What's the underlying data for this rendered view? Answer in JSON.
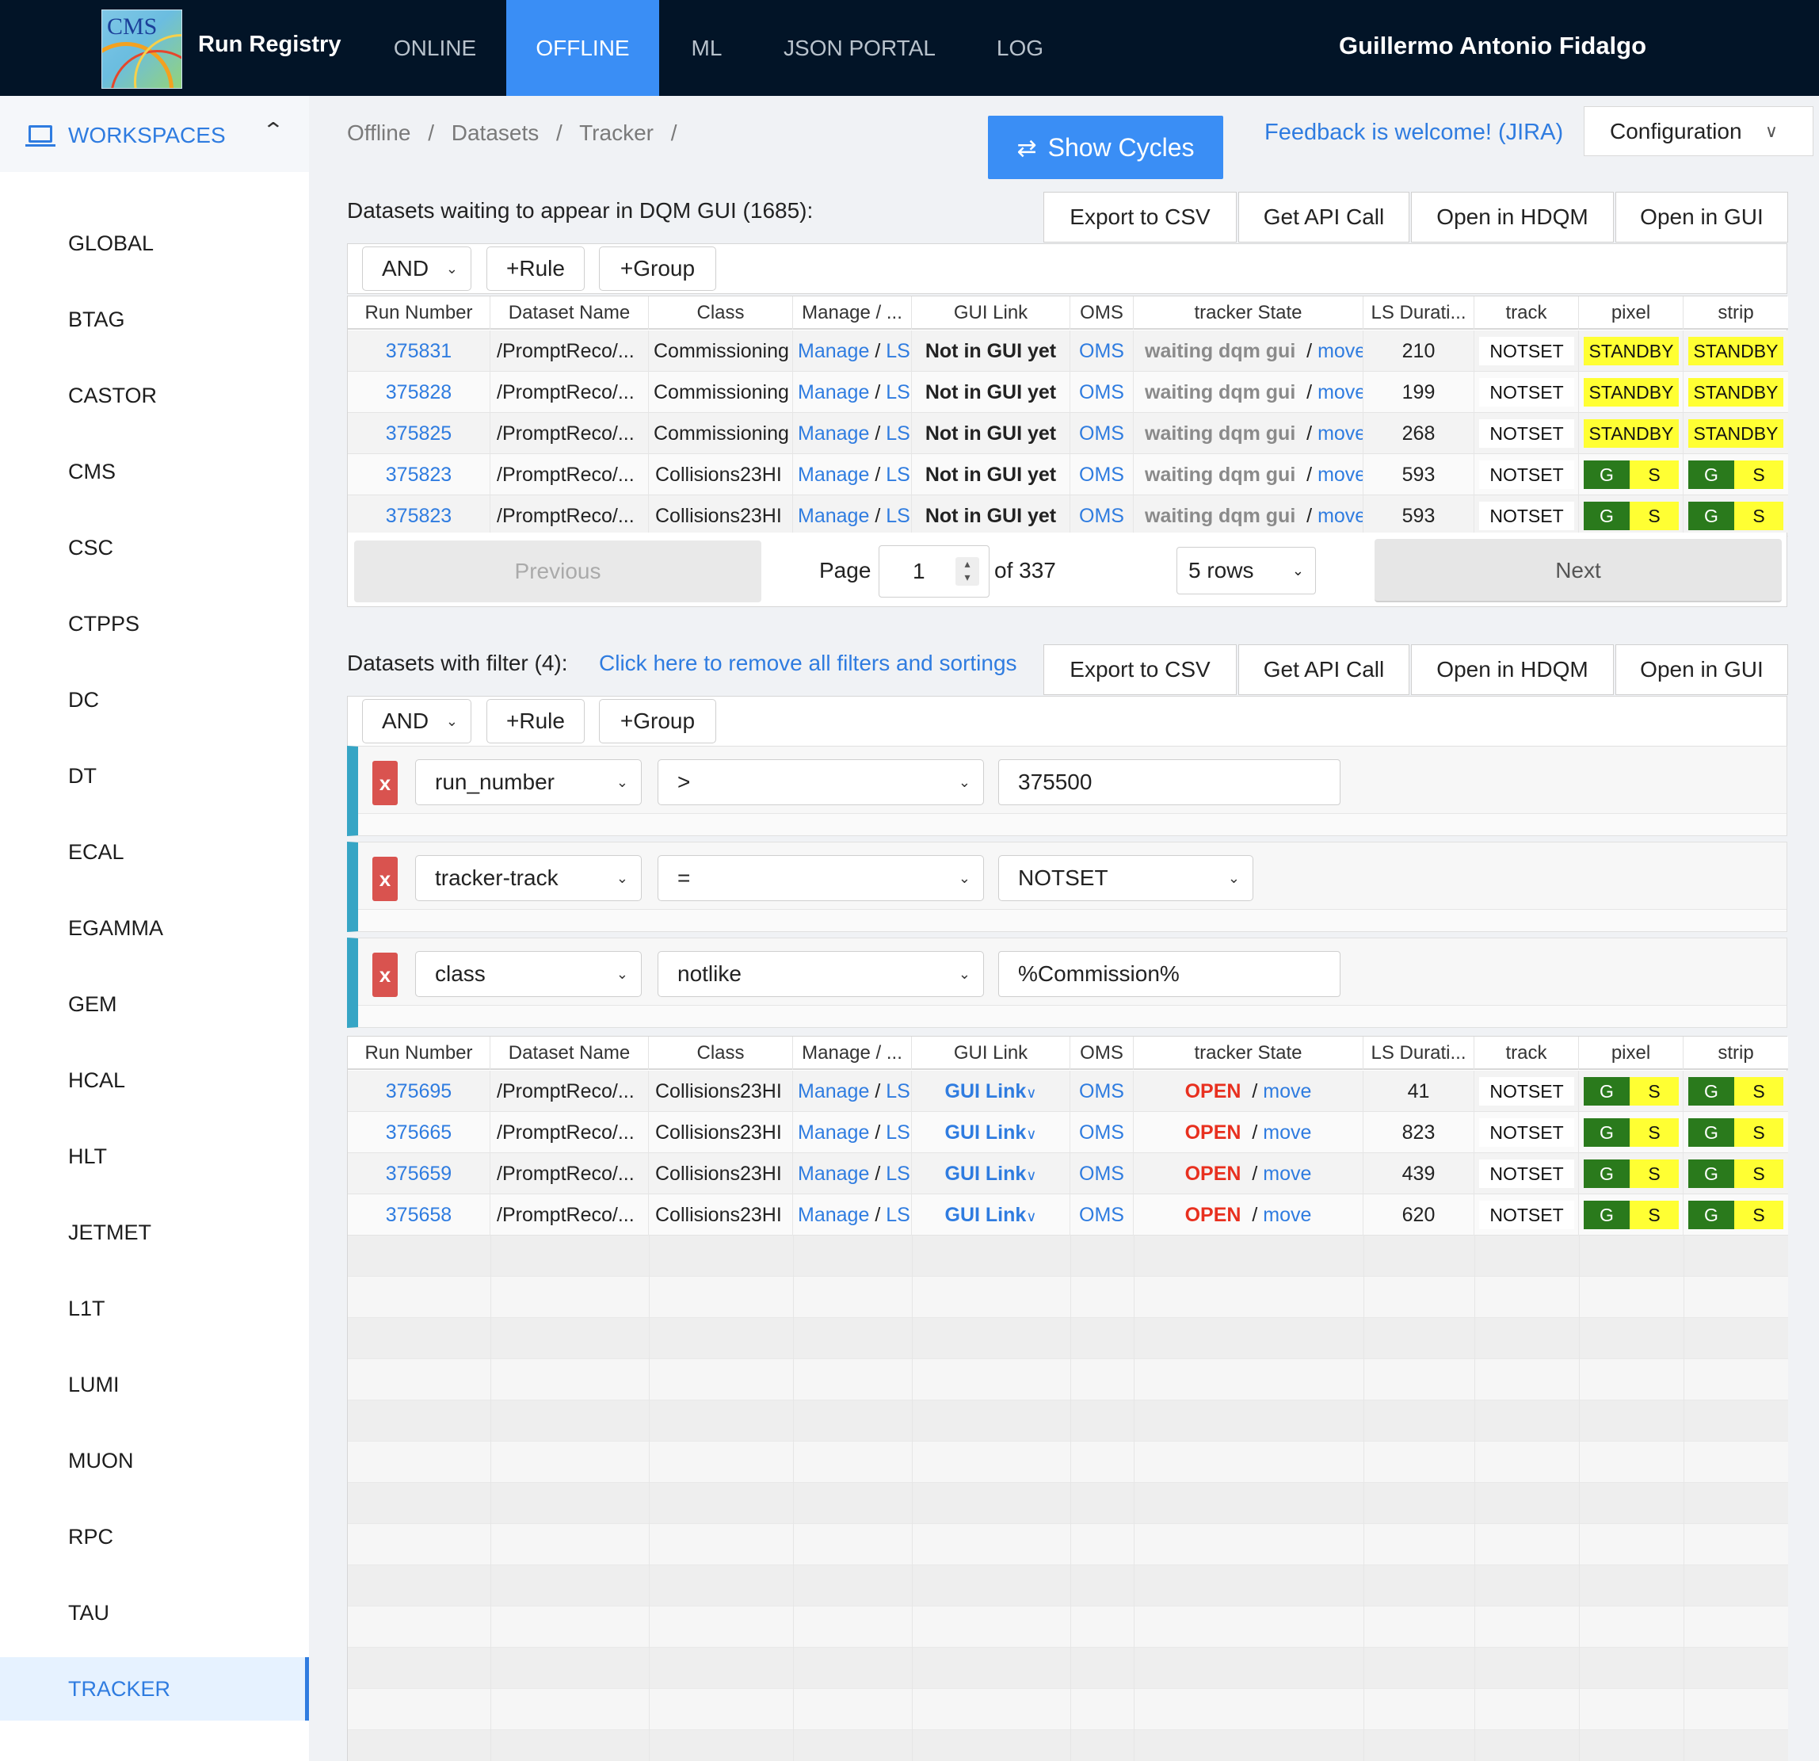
{
  "header": {
    "brand": "Run Registry",
    "logo_text": "CMS",
    "nav": [
      "ONLINE",
      "OFFLINE",
      "ML",
      "JSON PORTAL",
      "LOG"
    ],
    "active_nav": "OFFLINE",
    "user": "Guillermo Antonio Fidalgo",
    "colors": {
      "bar": "#021427",
      "active": "#3a8ef5"
    }
  },
  "sidebar": {
    "title": "WORKSPACES",
    "items": [
      "GLOBAL",
      "BTAG",
      "CASTOR",
      "CMS",
      "CSC",
      "CTPPS",
      "DC",
      "DT",
      "ECAL",
      "EGAMMA",
      "GEM",
      "HCAL",
      "HLT",
      "JETMET",
      "L1T",
      "LUMI",
      "MUON",
      "RPC",
      "TAU",
      "TRACKER"
    ],
    "active": "TRACKER"
  },
  "breadcrumb": [
    "Offline",
    "/",
    "Datasets",
    "/",
    "Tracker",
    "/"
  ],
  "toolbar": {
    "show_cycles": "Show Cycles",
    "feedback": "Feedback is welcome! (JIRA)",
    "configuration": "Configuration"
  },
  "actions": {
    "export_csv": "Export to CSV",
    "api_call": "Get API Call",
    "hdqm": "Open in HDQM",
    "gui": "Open in GUI"
  },
  "query_builder": {
    "combinator": "AND",
    "add_rule": "+Rule",
    "add_group": "+Group"
  },
  "columns": [
    "Run Number",
    "Dataset Name",
    "Class",
    "Manage / ...",
    "GUI Link",
    "OMS",
    "tracker State",
    "LS Durati...",
    "track",
    "pixel",
    "strip"
  ],
  "waiting": {
    "title": "Datasets waiting to appear in DQM GUI (1685):",
    "rows": [
      {
        "run": "375831",
        "dataset": "/PromptReco/...",
        "class": "Commissioning",
        "manage": "Manage",
        "sep": "/",
        "ls": "LS",
        "gui": "Not in GUI yet",
        "oms": "OMS",
        "state": "waiting dqm gui",
        "move": "move",
        "duration": "210",
        "track": "NOTSET",
        "pixel": "STANDBY",
        "strip": "STANDBY"
      },
      {
        "run": "375828",
        "dataset": "/PromptReco/...",
        "class": "Commissioning",
        "manage": "Manage",
        "sep": "/",
        "ls": "LS",
        "gui": "Not in GUI yet",
        "oms": "OMS",
        "state": "waiting dqm gui",
        "move": "move",
        "duration": "199",
        "track": "NOTSET",
        "pixel": "STANDBY",
        "strip": "STANDBY"
      },
      {
        "run": "375825",
        "dataset": "/PromptReco/...",
        "class": "Commissioning",
        "manage": "Manage",
        "sep": "/",
        "ls": "LS",
        "gui": "Not in GUI yet",
        "oms": "OMS",
        "state": "waiting dqm gui",
        "move": "move",
        "duration": "268",
        "track": "NOTSET",
        "pixel": "STANDBY",
        "strip": "STANDBY"
      },
      {
        "run": "375823",
        "dataset": "/PromptReco/...",
        "class": "Collisions23HI",
        "manage": "Manage",
        "sep": "/",
        "ls": "LS",
        "gui": "Not in GUI yet",
        "oms": "OMS",
        "state": "waiting dqm gui",
        "move": "move",
        "duration": "593",
        "track": "NOTSET",
        "pixel_g": "G",
        "pixel_s": "S",
        "strip_g": "G",
        "strip_s": "S"
      },
      {
        "run": "375823",
        "dataset": "/PromptReco/...",
        "class": "Collisions23HI",
        "manage": "Manage",
        "sep": "/",
        "ls": "LS",
        "gui": "Not in GUI yet",
        "oms": "OMS",
        "state": "waiting dqm gui",
        "move": "move",
        "duration": "593",
        "track": "NOTSET",
        "pixel_g": "G",
        "pixel_s": "S",
        "strip_g": "G",
        "strip_s": "S"
      }
    ],
    "pagination": {
      "previous": "Previous",
      "page_label": "Page",
      "page": "1",
      "of": "of 337",
      "rows": "5 rows",
      "next": "Next"
    }
  },
  "filtered": {
    "title": "Datasets with filter (4):",
    "remove_filters": "Click here to remove all filters and sortings",
    "rules": [
      {
        "field": "run_number",
        "op": ">",
        "value": "375500"
      },
      {
        "field": "tracker-track",
        "op": "=",
        "value": "NOTSET"
      },
      {
        "field": "class",
        "op": "notlike",
        "value": "%Commission%"
      }
    ],
    "remove_label": "x",
    "rows": [
      {
        "run": "375695",
        "dataset": "/PromptReco/...",
        "class": "Collisions23HI",
        "manage": "Manage",
        "sep": "/",
        "ls": "LS",
        "gui": "GUI Link",
        "oms": "OMS",
        "state": "OPEN",
        "move": "move",
        "duration": "41",
        "track": "NOTSET",
        "pixel_g": "G",
        "pixel_s": "S",
        "strip_g": "G",
        "strip_s": "S"
      },
      {
        "run": "375665",
        "dataset": "/PromptReco/...",
        "class": "Collisions23HI",
        "manage": "Manage",
        "sep": "/",
        "ls": "LS",
        "gui": "GUI Link",
        "oms": "OMS",
        "state": "OPEN",
        "move": "move",
        "duration": "823",
        "track": "NOTSET",
        "pixel_g": "G",
        "pixel_s": "S",
        "strip_g": "G",
        "strip_s": "S"
      },
      {
        "run": "375659",
        "dataset": "/PromptReco/...",
        "class": "Collisions23HI",
        "manage": "Manage",
        "sep": "/",
        "ls": "LS",
        "gui": "GUI Link",
        "oms": "OMS",
        "state": "OPEN",
        "move": "move",
        "duration": "439",
        "track": "NOTSET",
        "pixel_g": "G",
        "pixel_s": "S",
        "strip_g": "G",
        "strip_s": "S"
      },
      {
        "run": "375658",
        "dataset": "/PromptReco/...",
        "class": "Collisions23HI",
        "manage": "Manage",
        "sep": "/",
        "ls": "LS",
        "gui": "GUI Link",
        "oms": "OMS",
        "state": "OPEN",
        "move": "move",
        "duration": "620",
        "track": "NOTSET",
        "pixel_g": "G",
        "pixel_s": "S",
        "strip_g": "G",
        "strip_s": "S"
      }
    ]
  },
  "status_colors": {
    "good": "#2a7a1c",
    "standby": "#ffff33",
    "open": "#e8301f",
    "link": "#2f7ce0"
  }
}
